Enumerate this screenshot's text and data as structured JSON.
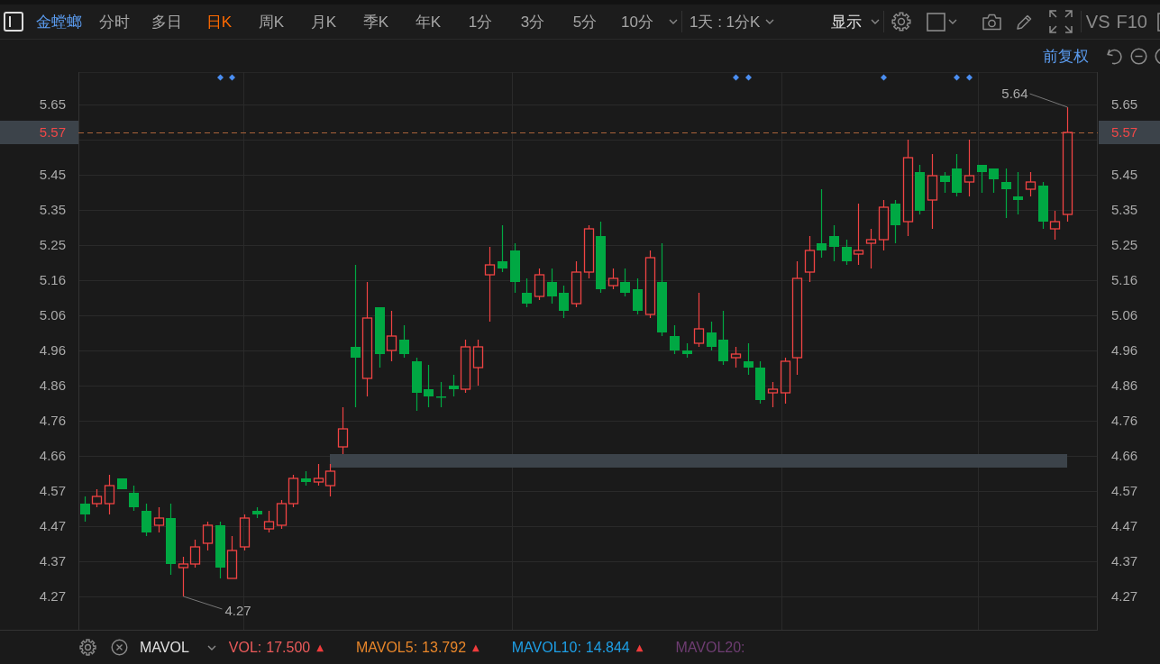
{
  "toolbar": {
    "stock_name": "金螳螂",
    "periods": [
      {
        "label": "分时",
        "selected": false
      },
      {
        "label": "多日",
        "selected": false
      },
      {
        "label": "日K",
        "selected": true
      },
      {
        "label": "周K",
        "selected": false
      },
      {
        "label": "月K",
        "selected": false
      },
      {
        "label": "季K",
        "selected": false
      },
      {
        "label": "年K",
        "selected": false
      },
      {
        "label": "1分",
        "selected": false
      },
      {
        "label": "3分",
        "selected": false
      },
      {
        "label": "5分",
        "selected": false
      },
      {
        "label": "10分",
        "selected": false
      }
    ],
    "interval_menu": "1天 : 1分K",
    "display_menu": "显示",
    "compare_button": "VS",
    "f10_button": "F10"
  },
  "chart": {
    "adjustment": "前复权",
    "left_axis": {
      "current_price": "5.57"
    },
    "chart_data": {
      "type": "candlestick",
      "grid": true,
      "categories": [
        null,
        null,
        null,
        null,
        null,
        null,
        null,
        null,
        null,
        null,
        null,
        null,
        null,
        null,
        null,
        null,
        null,
        null,
        null,
        null,
        null,
        null,
        null,
        null,
        null,
        null,
        null,
        null,
        null,
        null,
        null,
        null,
        null,
        null,
        null,
        null,
        null,
        null,
        null,
        null,
        null,
        null,
        null,
        null,
        null,
        null,
        null,
        null,
        null,
        null,
        null,
        null,
        null,
        null,
        null,
        null,
        null,
        null,
        null,
        null,
        null,
        null,
        null,
        null,
        null,
        null,
        null,
        null,
        null,
        null,
        null,
        null,
        null,
        null,
        null,
        null,
        null,
        null,
        null,
        null,
        null,
        null,
        null
      ],
      "ylim": [
        4.1741,
        5.7392
      ],
      "yticks": [
        {
          "value": 5.6483,
          "label": "5.65"
        },
        {
          "value": 5.4514,
          "label": "5.45"
        },
        {
          "value": 5.353,
          "label": "5.35"
        },
        {
          "value": 5.2545,
          "label": "5.25"
        },
        {
          "value": 5.1561,
          "label": "5.16"
        },
        {
          "value": 5.0576,
          "label": "5.06"
        },
        {
          "value": 4.9592,
          "label": "4.96"
        },
        {
          "value": 4.8607,
          "label": "4.86"
        },
        {
          "value": 4.7623,
          "label": "4.76"
        },
        {
          "value": 4.6638,
          "label": "4.66"
        },
        {
          "value": 4.5654,
          "label": "4.57"
        },
        {
          "value": 4.4669,
          "label": "4.47"
        },
        {
          "value": 4.3685,
          "label": "4.37"
        },
        4.27
      ],
      "ref_lines": [
        {
          "axis": "y",
          "value": 5.57
        }
      ],
      "bands": [
        {
          "axis": "y",
          "from": 4.631,
          "to": 4.669
        }
      ],
      "ohlc": [
        [
          4.53,
          4.55,
          4.48,
          4.5
        ],
        [
          4.53,
          4.57,
          4.52,
          4.55
        ],
        [
          4.53,
          4.61,
          4.5,
          4.58
        ],
        [
          4.6,
          4.6,
          4.57,
          4.57
        ],
        [
          4.56,
          4.58,
          4.51,
          4.52
        ],
        [
          4.51,
          4.53,
          4.44,
          4.45
        ],
        [
          4.47,
          4.52,
          4.45,
          4.49
        ],
        [
          4.49,
          4.53,
          4.33,
          4.36
        ],
        [
          4.35,
          4.38,
          4.27,
          4.36
        ],
        [
          4.36,
          4.43,
          4.35,
          4.41
        ],
        [
          4.42,
          4.48,
          4.4,
          4.47
        ],
        [
          4.47,
          4.48,
          4.32,
          4.35
        ],
        [
          4.32,
          4.44,
          4.32,
          4.4
        ],
        [
          4.41,
          4.5,
          4.4,
          4.49
        ],
        [
          4.51,
          4.52,
          4.49,
          4.5
        ],
        [
          4.46,
          4.51,
          4.45,
          4.48
        ],
        [
          4.47,
          4.54,
          4.46,
          4.53
        ],
        [
          4.53,
          4.61,
          4.52,
          4.6
        ],
        [
          4.6,
          4.62,
          4.58,
          4.59
        ],
        [
          4.59,
          4.64,
          4.58,
          4.6
        ],
        [
          4.58,
          4.64,
          4.55,
          4.62
        ],
        [
          4.69,
          4.8,
          4.67,
          4.74
        ],
        [
          4.97,
          5.2,
          4.8,
          4.94
        ],
        [
          4.88,
          5.15,
          4.83,
          5.05
        ],
        [
          5.08,
          5.08,
          4.91,
          4.95
        ],
        [
          4.96,
          5.07,
          4.93,
          5.0
        ],
        [
          4.99,
          5.03,
          4.94,
          4.95
        ],
        [
          4.93,
          4.94,
          4.79,
          4.84
        ],
        [
          4.85,
          4.92,
          4.8,
          4.83
        ],
        [
          4.83,
          4.87,
          4.8,
          4.83
        ],
        [
          4.86,
          4.89,
          4.83,
          4.85
        ],
        [
          4.85,
          4.99,
          4.84,
          4.97
        ],
        [
          4.91,
          4.99,
          4.86,
          4.97
        ],
        [
          5.17,
          5.25,
          5.04,
          5.2
        ],
        [
          5.21,
          5.31,
          5.18,
          5.19
        ],
        [
          5.24,
          5.26,
          5.12,
          5.15
        ],
        [
          5.12,
          5.16,
          5.08,
          5.09
        ],
        [
          5.11,
          5.19,
          5.1,
          5.17
        ],
        [
          5.15,
          5.19,
          5.09,
          5.11
        ],
        [
          5.12,
          5.14,
          5.05,
          5.07
        ],
        [
          5.09,
          5.21,
          5.08,
          5.18
        ],
        [
          5.18,
          5.31,
          5.16,
          5.3
        ],
        [
          5.28,
          5.32,
          5.12,
          5.13
        ],
        [
          5.14,
          5.19,
          5.13,
          5.16
        ],
        [
          5.15,
          5.19,
          5.11,
          5.12
        ],
        [
          5.13,
          5.16,
          5.06,
          5.07
        ],
        [
          5.06,
          5.24,
          5.05,
          5.22
        ],
        [
          5.15,
          5.26,
          5.0,
          5.01
        ],
        [
          5.0,
          5.03,
          4.95,
          4.96
        ],
        [
          4.96,
          4.98,
          4.94,
          4.95
        ],
        [
          4.98,
          5.12,
          4.97,
          5.02
        ],
        [
          5.01,
          5.04,
          4.96,
          4.97
        ],
        [
          4.99,
          5.07,
          4.92,
          4.93
        ],
        [
          4.94,
          4.97,
          4.91,
          4.95
        ],
        [
          4.93,
          4.98,
          4.89,
          4.91
        ],
        [
          4.91,
          4.93,
          4.81,
          4.82
        ],
        [
          4.84,
          4.87,
          4.8,
          4.85
        ],
        [
          4.84,
          4.94,
          4.81,
          4.93
        ],
        [
          4.94,
          5.21,
          4.89,
          5.16
        ],
        [
          5.18,
          5.28,
          5.15,
          5.24
        ],
        [
          5.26,
          5.41,
          5.22,
          5.24
        ],
        [
          5.28,
          5.31,
          5.21,
          5.25
        ],
        [
          5.25,
          5.27,
          5.2,
          5.21
        ],
        [
          5.23,
          5.37,
          5.2,
          5.24
        ],
        [
          5.26,
          5.3,
          5.19,
          5.27
        ],
        [
          5.27,
          5.38,
          5.24,
          5.36
        ],
        [
          5.37,
          5.38,
          5.26,
          5.31
        ],
        [
          5.32,
          5.55,
          5.28,
          5.5
        ],
        [
          5.46,
          5.48,
          5.34,
          5.35
        ],
        [
          5.38,
          5.51,
          5.3,
          5.45
        ],
        [
          5.45,
          5.46,
          5.4,
          5.43
        ],
        [
          5.47,
          5.51,
          5.39,
          5.4
        ],
        [
          5.43,
          5.55,
          5.39,
          5.45
        ],
        [
          5.48,
          5.48,
          5.4,
          5.46
        ],
        [
          5.47,
          5.47,
          5.4,
          5.44
        ],
        [
          5.43,
          5.47,
          5.33,
          5.41
        ],
        [
          5.39,
          5.46,
          5.34,
          5.38
        ],
        [
          5.41,
          5.46,
          5.39,
          5.43
        ],
        [
          5.42,
          5.43,
          5.3,
          5.32
        ],
        [
          5.3,
          5.35,
          5.27,
          5.32
        ],
        [
          5.34,
          5.64,
          5.32,
          5.57
        ],
        null,
        null
      ]
    },
    "right_axis": {
      "current_price": "5.57",
      "ticks": [
        {
          "label": "5.65"
        },
        {
          "label": "5.45"
        },
        {
          "label": "5.35"
        },
        {
          "label": "5.25"
        },
        {
          "label": "5.16"
        },
        {
          "label": "5.06"
        },
        {
          "label": "4.96"
        },
        {
          "label": "4.86"
        },
        {
          "label": "4.76"
        },
        {
          "label": "4.66"
        },
        {
          "label": "4.57"
        },
        {
          "label": "4.47"
        },
        {
          "label": "4.37"
        },
        {
          "label": "4.27"
        }
      ]
    },
    "high_label": "5.64",
    "low_label": "4.27"
  },
  "indicator_bar": {
    "indicator": "MAVOL",
    "readings": [
      {
        "label": "VOL:",
        "value": "17.500",
        "color": "#ec5b5b",
        "trend_mark": "▲"
      },
      {
        "label": "MAVOL5:",
        "value": "13.792",
        "color": "#e8862a",
        "trend_mark": "▲"
      },
      {
        "label": "MAVOL10:",
        "value": "14.844",
        "color": "#1e9fe6",
        "trend_mark": "▲"
      },
      {
        "label": "MAVOL20:",
        "color": "#6e3d72"
      }
    ]
  }
}
